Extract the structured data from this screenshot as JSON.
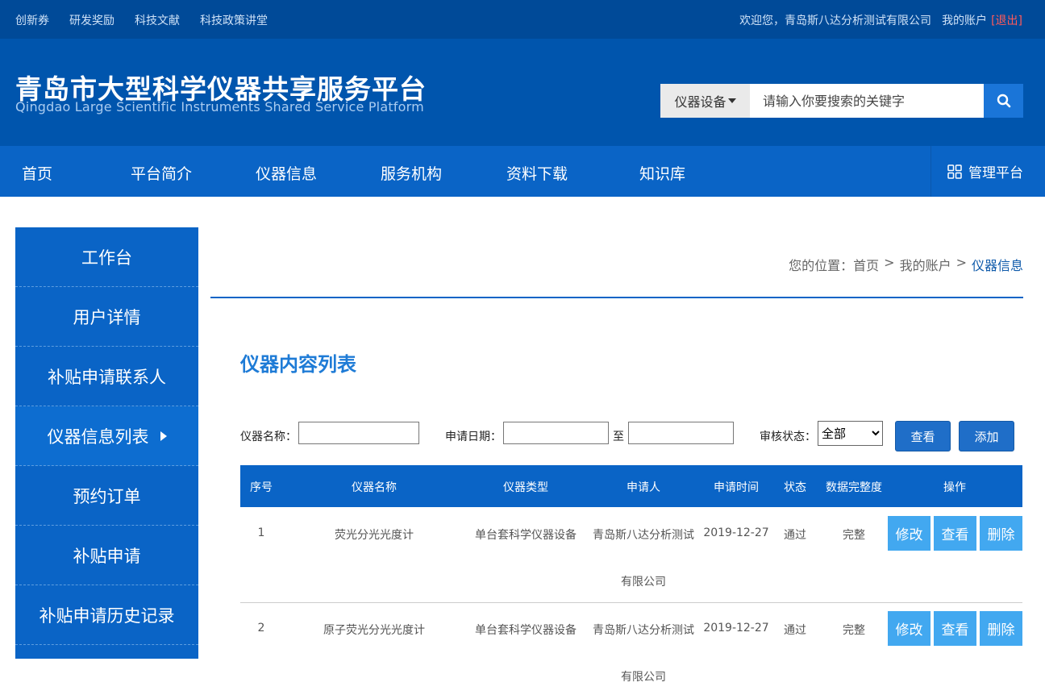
{
  "topbar": {
    "links": [
      "创新券",
      "研发奖励",
      "科技文献",
      "科技政策讲堂"
    ],
    "welcome": "欢迎您，青岛斯八达分析测试有限公司",
    "account": "我的账户",
    "logout": "[退出]"
  },
  "header": {
    "title_cn": "青岛市大型科学仪器共享服务平台",
    "title_en": "Qingdao Large Scientific Instruments Shared Service Platform",
    "search": {
      "category": "仪器设备",
      "placeholder": "请输入你要搜索的关键字"
    }
  },
  "nav": {
    "items": [
      "首页",
      "平台简介",
      "仪器信息",
      "服务机构",
      "资料下载",
      "知识库"
    ],
    "management": "管理平台"
  },
  "sidebar": {
    "items": [
      "工作台",
      "用户详情",
      "补贴申请联系人",
      "仪器信息列表",
      "预约订单",
      "补贴申请",
      "补贴申请历史记录"
    ]
  },
  "breadcrumb": {
    "prefix": "您的位置：",
    "home": "首页",
    "sep": ">",
    "account": "我的账户",
    "current": "仪器信息"
  },
  "page": {
    "title": "仪器内容列表"
  },
  "filter": {
    "name_label": "仪器名称：",
    "date_label": "申请日期：",
    "to_label": "至",
    "status_label": "审核状态：",
    "status_value": "全部",
    "view_button": "查看",
    "add_button": "添加"
  },
  "table": {
    "headers": [
      "序号",
      "仪器名称",
      "仪器类型",
      "申请人",
      "申请时间",
      "状态",
      "数据完整度",
      "操作"
    ],
    "rows": [
      {
        "no": "1",
        "name": "荧光分光光度计",
        "type": "单台套科学仪器设备",
        "applicant_line1": "青岛斯八达分析测试",
        "applicant_line2": "有限公司",
        "date": "2019-12-27",
        "status": "通过",
        "completeness": "完整"
      },
      {
        "no": "2",
        "name": "原子荧光分光光度计",
        "type": "单台套科学仪器设备",
        "applicant_line1": "青岛斯八达分析测试",
        "applicant_line2": "有限公司",
        "date": "2019-12-27",
        "status": "通过",
        "completeness": "完整"
      }
    ],
    "ops": {
      "edit": "修改",
      "view": "查看",
      "delete": "删除"
    }
  }
}
